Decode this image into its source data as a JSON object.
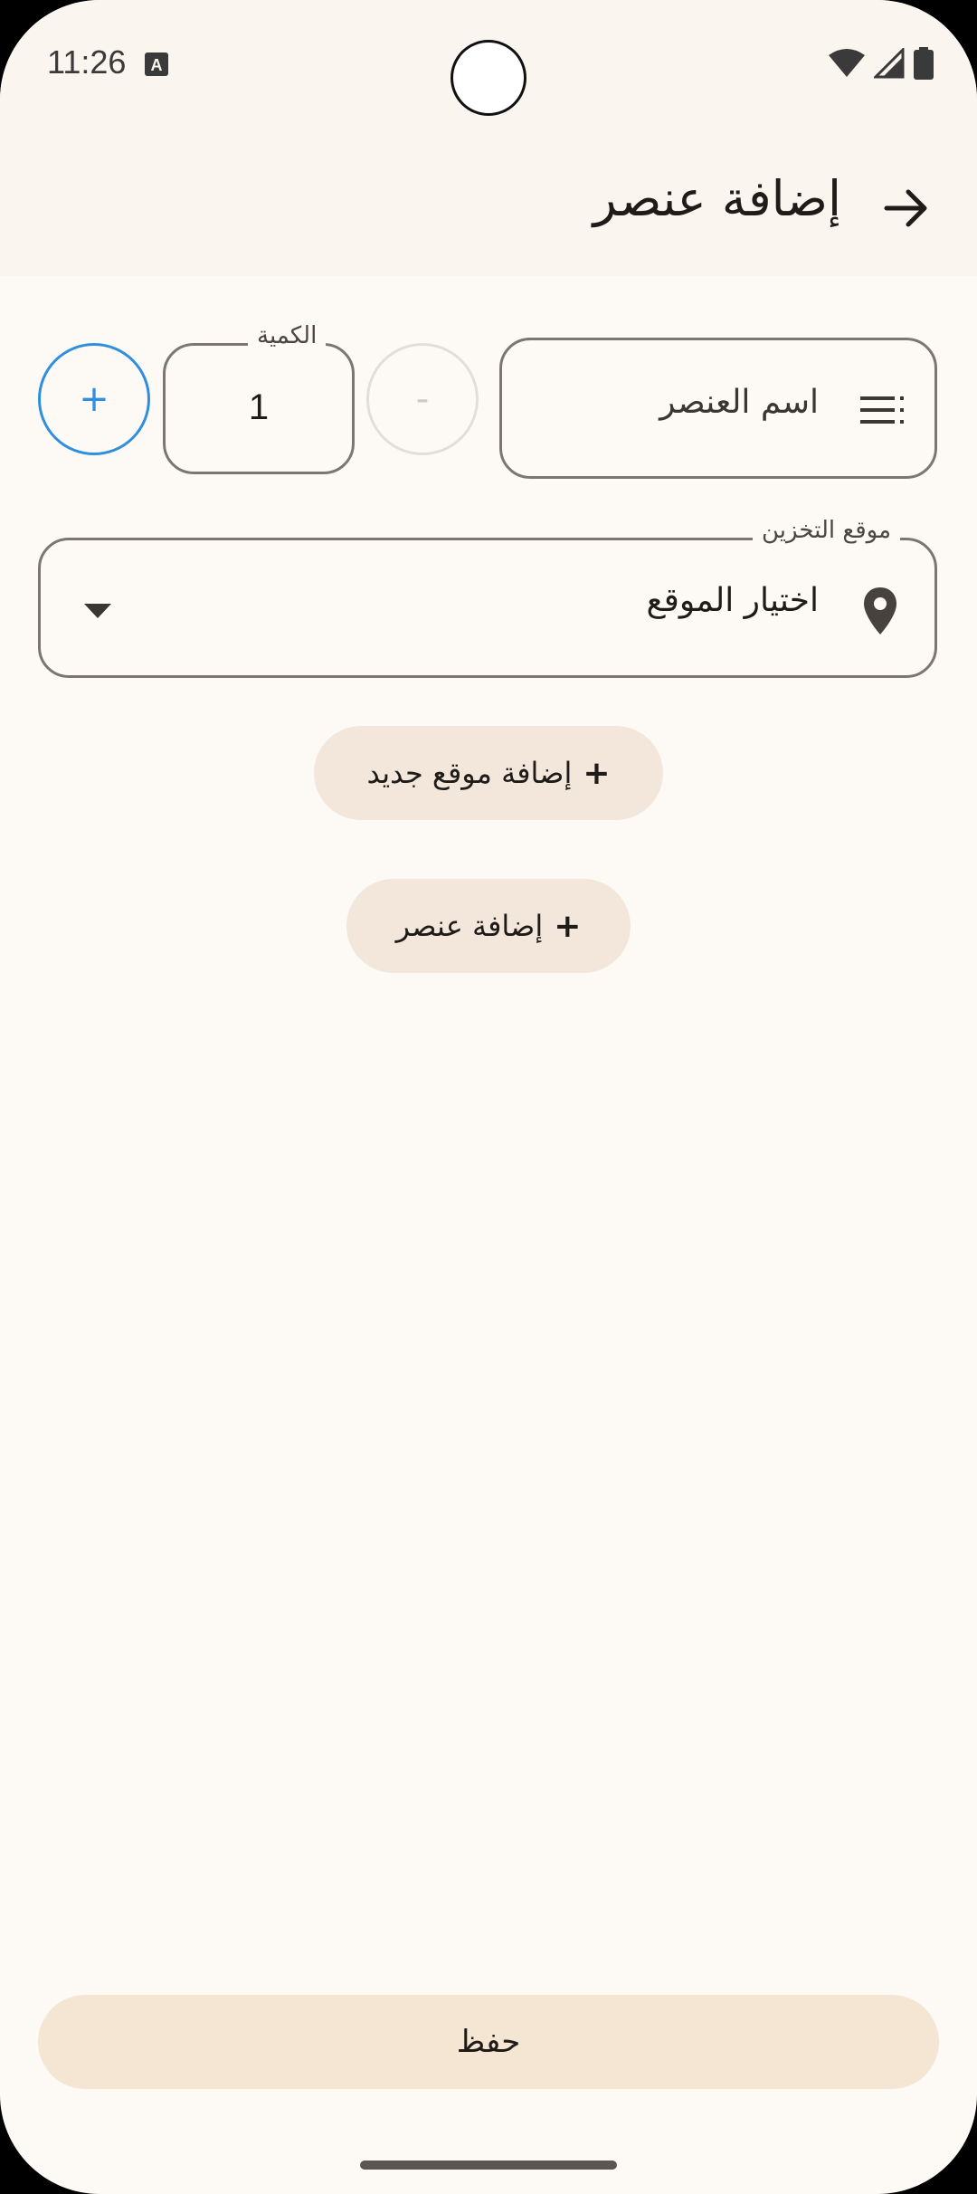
{
  "status_bar": {
    "time": "11:26",
    "icons": [
      "keyboard-a-icon",
      "wifi-icon",
      "cellular-icon",
      "battery-icon"
    ]
  },
  "app_bar": {
    "title": "إضافة عنصر",
    "back_icon": "arrow-right-icon"
  },
  "item_name": {
    "placeholder": "اسم العنصر",
    "icon": "list-icon"
  },
  "quantity": {
    "label": "الكمية",
    "value": "1",
    "decrement_label": "-",
    "increment_label": "+"
  },
  "storage_location": {
    "label": "موقع التخزين",
    "selected": "اختيار الموقع",
    "icon": "location-pin-icon",
    "dropdown_icon": "dropdown-arrow-icon"
  },
  "actions": {
    "add_location": {
      "plus": "+",
      "label": "إضافة موقع جديد"
    },
    "add_item": {
      "plus": "+",
      "label": "إضافة عنصر"
    },
    "save": "حفظ"
  },
  "colors": {
    "background": "#fdfaf6",
    "app_bar": "#fbf5ef",
    "outline": "#7b766f",
    "accent_blue": "#2f8fde",
    "tonal_button": "#f3e7dc",
    "save_button": "#f5e6d4"
  }
}
